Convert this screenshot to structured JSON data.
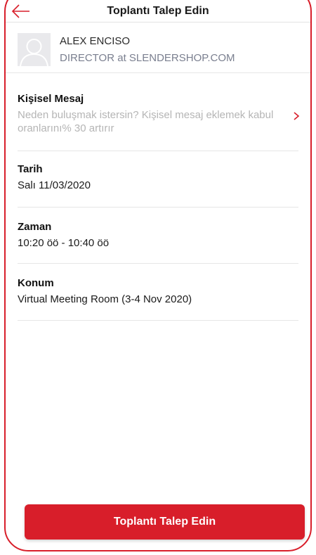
{
  "header": {
    "title": "Toplantı Talep Edin",
    "back_icon": "arrow-left-icon"
  },
  "profile": {
    "name": "ALEX ENCISO",
    "job_title": "DIRECTOR at SLENDERSHOP.COM",
    "avatar_icon": "user-avatar-placeholder"
  },
  "personal_message": {
    "label": "Kişisel Mesaj",
    "placeholder": "Neden buluşmak istersin? Kişisel mesaj eklemek kabul oranlarını% 30 artırır",
    "chevron_icon": "chevron-right-icon"
  },
  "date": {
    "label": "Tarih",
    "value": "Salı 11/03/2020"
  },
  "time": {
    "label": "Zaman",
    "value": "10:20 öö - 10:40 öö"
  },
  "location": {
    "label": "Konum",
    "value": "Virtual Meeting Room (3-4 Nov 2020)"
  },
  "submit": {
    "label": "Toplantı Talep Edin"
  },
  "colors": {
    "accent": "#d81e2a",
    "muted_text": "#7a7f8f",
    "placeholder_text": "#b5b5b5"
  }
}
